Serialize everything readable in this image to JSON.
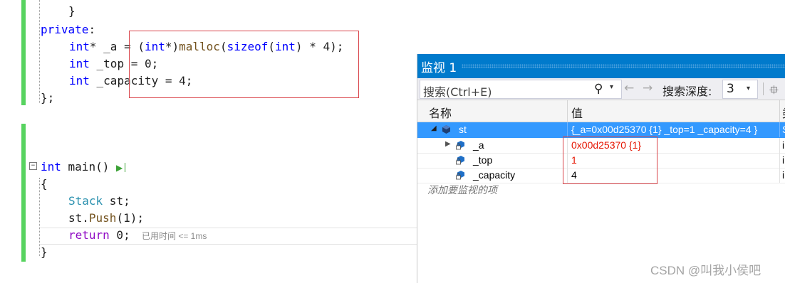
{
  "editor": {
    "lines": {
      "brace_close_fn": "}",
      "private_kw": "private",
      "colon": ":",
      "a_type": "int",
      "a_star": "* _a = (",
      "a_cast_type": "int",
      "a_cast_star": "*)",
      "a_malloc": "malloc",
      "a_paren": "(",
      "a_sizeof": "sizeof",
      "a_paren2": "(",
      "a_int2": "int",
      "a_rest": ") * 4);",
      "top_type": "int",
      "top_rest": " _top = 0;",
      "cap_type": "int",
      "cap_rest": " _capacity = 4;",
      "class_close": "};",
      "main_type": "int",
      "main_rest": " main()",
      "main_open": "{",
      "stack_type": "Stack",
      "stack_rest": " st;",
      "push_obj": "st.",
      "push_fn": "Push",
      "push_rest": "(1);",
      "return_kw": "return",
      "return_rest": " 0;",
      "main_close": "}"
    },
    "fold_glyph": "−",
    "run_glyph": "▶",
    "elapsed": "已用时间 <= 1ms"
  },
  "watch": {
    "title": "监视 1",
    "search_placeholder": "搜索(Ctrl+E)",
    "search_icon": "search-icon",
    "search_glyph": "⚲",
    "dropdown_glyph": "▾",
    "back_glyph": "←",
    "forward_glyph": "→",
    "depth_label": "搜索深度:",
    "depth_value": "3",
    "filter_glyph": "⯐",
    "columns": {
      "name": "名称",
      "value": "值",
      "type": "类"
    },
    "rows": [
      {
        "name": "st",
        "value": "{_a=0x00d25370 {1} _top=1 _capacity=4 }",
        "type": "S",
        "expand": "◢"
      },
      {
        "name": "_a",
        "value": "0x00d25370 {1}",
        "type": "i",
        "expand": "▶"
      },
      {
        "name": "_top",
        "value": "1",
        "type": "i",
        "expand": ""
      },
      {
        "name": "_capacity",
        "value": "4",
        "type": "i",
        "expand": ""
      }
    ],
    "add_item": "添加要监视的项"
  },
  "watermark": "CSDN @叫我小侯吧",
  "colors": {
    "accent": "#007acc",
    "selection": "#3399ff",
    "highlight_box": "#d9444a",
    "changed_value": "#e51400",
    "change_bar": "#57d35f"
  }
}
